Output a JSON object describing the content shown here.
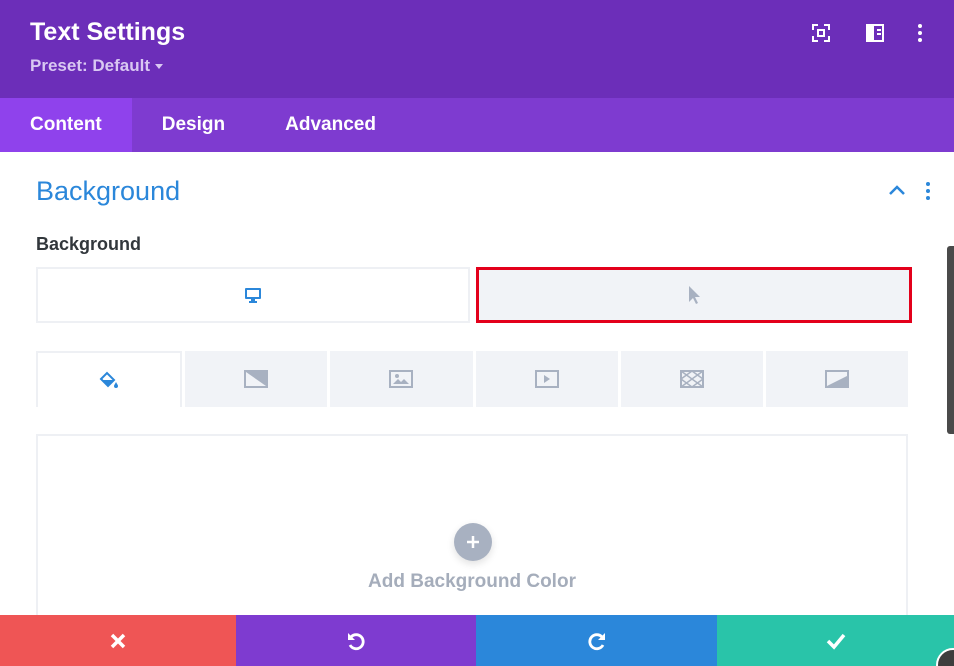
{
  "modal": {
    "title": "Text Settings",
    "preset": "Preset: Default",
    "header_icons": [
      "fullscreen-icon",
      "sidebar-layout-icon",
      "more-vertical-icon"
    ]
  },
  "tabs": [
    {
      "label": "Content",
      "active": true
    },
    {
      "label": "Design",
      "active": false
    },
    {
      "label": "Advanced",
      "active": false
    }
  ],
  "section": {
    "title": "Background",
    "field_label": "Background",
    "state_tabs": [
      {
        "icon": "desktop-icon",
        "active": true
      },
      {
        "icon": "cursor-hover-icon",
        "active": false,
        "highlighted": true
      }
    ],
    "background_types": [
      {
        "icon": "paint-bucket-icon",
        "active": true
      },
      {
        "icon": "gradient-icon",
        "active": false
      },
      {
        "icon": "image-icon",
        "active": false
      },
      {
        "icon": "video-icon",
        "active": false
      },
      {
        "icon": "pattern-icon",
        "active": false
      },
      {
        "icon": "mask-icon",
        "active": false
      }
    ],
    "add_color_label": "Add Background Color"
  },
  "footer": {
    "buttons": [
      "close-icon",
      "undo-icon",
      "redo-icon",
      "check-icon"
    ]
  },
  "colors": {
    "header": "#6c2eb9",
    "tabs": "#7e3bd0",
    "active_tab": "#8f42ec",
    "accent_blue": "#2b87da",
    "cancel": "#ef5555",
    "save": "#29c4a9",
    "highlight": "#e3001b"
  }
}
